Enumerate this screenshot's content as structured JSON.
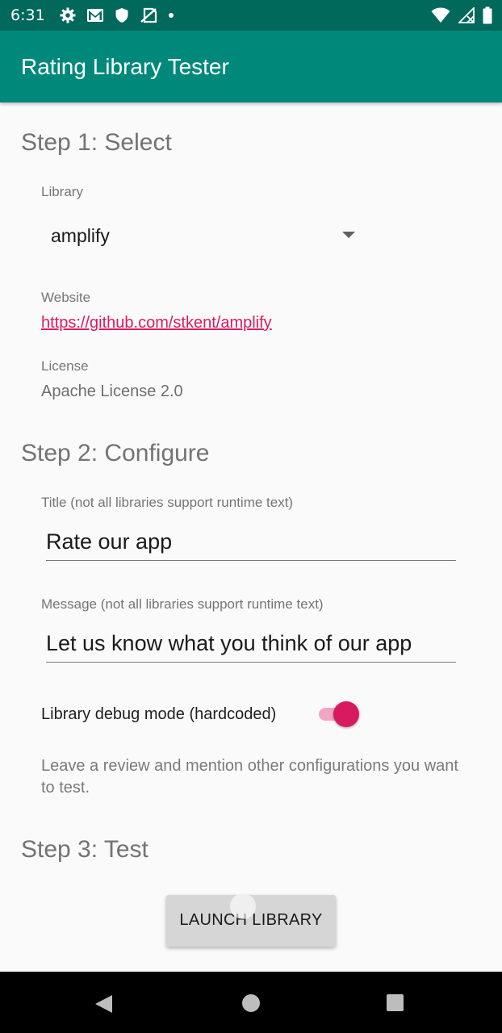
{
  "status_bar": {
    "time": "6:31",
    "icons": [
      "gear-icon",
      "gmail-icon",
      "shield-icon",
      "no-sim-icon",
      "dot-icon",
      "wifi-icon",
      "signal-icon",
      "battery-icon"
    ]
  },
  "app_bar": {
    "title": "Rating Library Tester"
  },
  "step1": {
    "heading": "Step 1: Select",
    "library_label": "Library",
    "library_value": "amplify",
    "website_label": "Website",
    "website_value": "https://github.com/stkent/amplify",
    "license_label": "License",
    "license_value": "Apache License 2.0"
  },
  "step2": {
    "heading": "Step 2: Configure",
    "title_label": "Title (not all libraries support runtime text)",
    "title_value": "Rate our app",
    "message_label": "Message (not all libraries support runtime text)",
    "message_value": "Let us know what you think of our app",
    "debug_label": "Library debug mode (hardcoded)",
    "debug_enabled": true,
    "hint": "Leave a review and mention other configurations you want to test."
  },
  "step3": {
    "heading": "Step 3: Test",
    "launch_label": "LAUNCH LIBRARY"
  },
  "colors": {
    "status_bar": "#00695c",
    "app_bar": "#00897b",
    "accent": "#d81b60"
  }
}
